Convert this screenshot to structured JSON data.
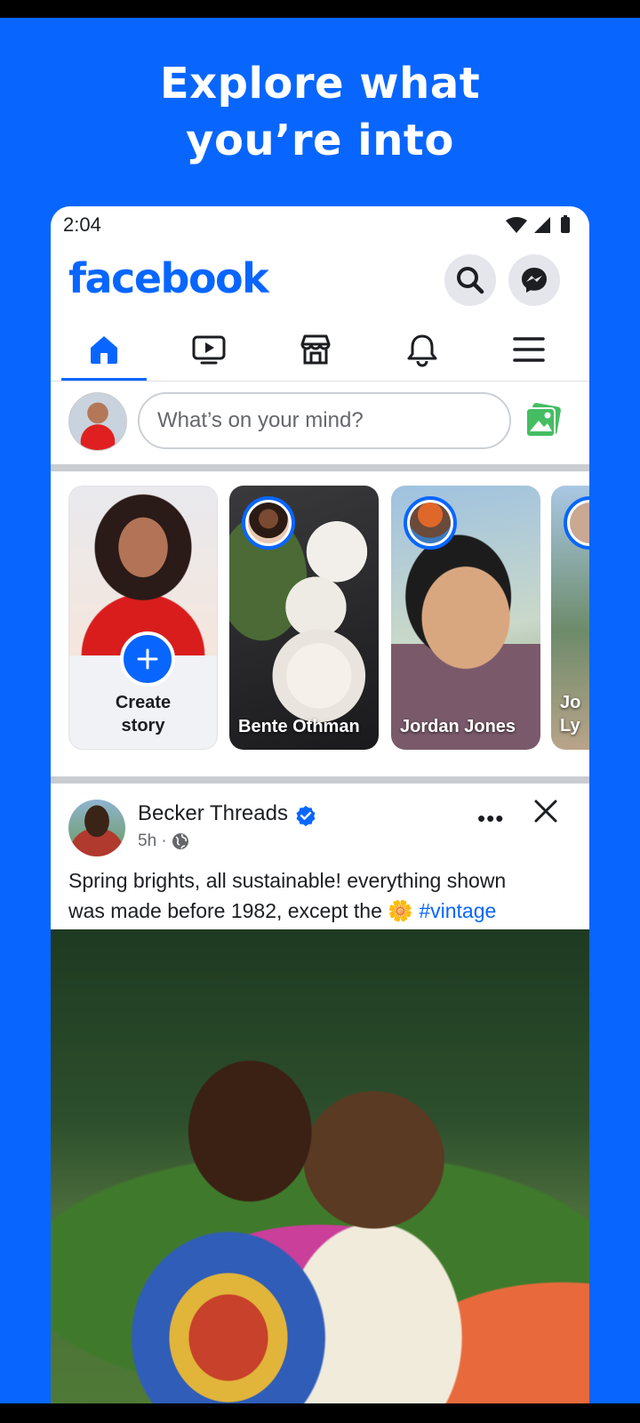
{
  "promo": {
    "headline_line1": "Explore what",
    "headline_line2": "you’re into"
  },
  "status_bar": {
    "time": "2:04",
    "icons": [
      "wifi-icon",
      "signal-icon",
      "battery-icon"
    ]
  },
  "app_bar": {
    "logo": "facebook",
    "actions": [
      "search-icon",
      "messenger-icon"
    ]
  },
  "nav_tabs": [
    {
      "name": "home",
      "icon": "home-icon",
      "active": true
    },
    {
      "name": "watch",
      "icon": "video-icon",
      "active": false
    },
    {
      "name": "marketplace",
      "icon": "marketplace-icon",
      "active": false
    },
    {
      "name": "notifications",
      "icon": "bell-icon",
      "active": false
    },
    {
      "name": "menu",
      "icon": "hamburger-icon",
      "active": false
    }
  ],
  "composer": {
    "placeholder": "What’s on your mind?"
  },
  "stories": {
    "create_line1": "Create",
    "create_line2": "story",
    "items": [
      {
        "name": "Bente Othman"
      },
      {
        "name": "Jordan Jones"
      },
      {
        "name": "Jo Ly"
      }
    ]
  },
  "post": {
    "author": "Becker Threads",
    "verified": true,
    "time": "5h ·",
    "caption_line1": "Spring brights, all sustainable! everything shown",
    "caption_line2": "was made before 1982, except the",
    "emoji": "🌼",
    "hashtag": "#vintage",
    "more": "•••"
  },
  "colors": {
    "brand": "#0866ff",
    "background": "#0866ff",
    "text": "#1c1e21",
    "muted": "#65676b"
  }
}
